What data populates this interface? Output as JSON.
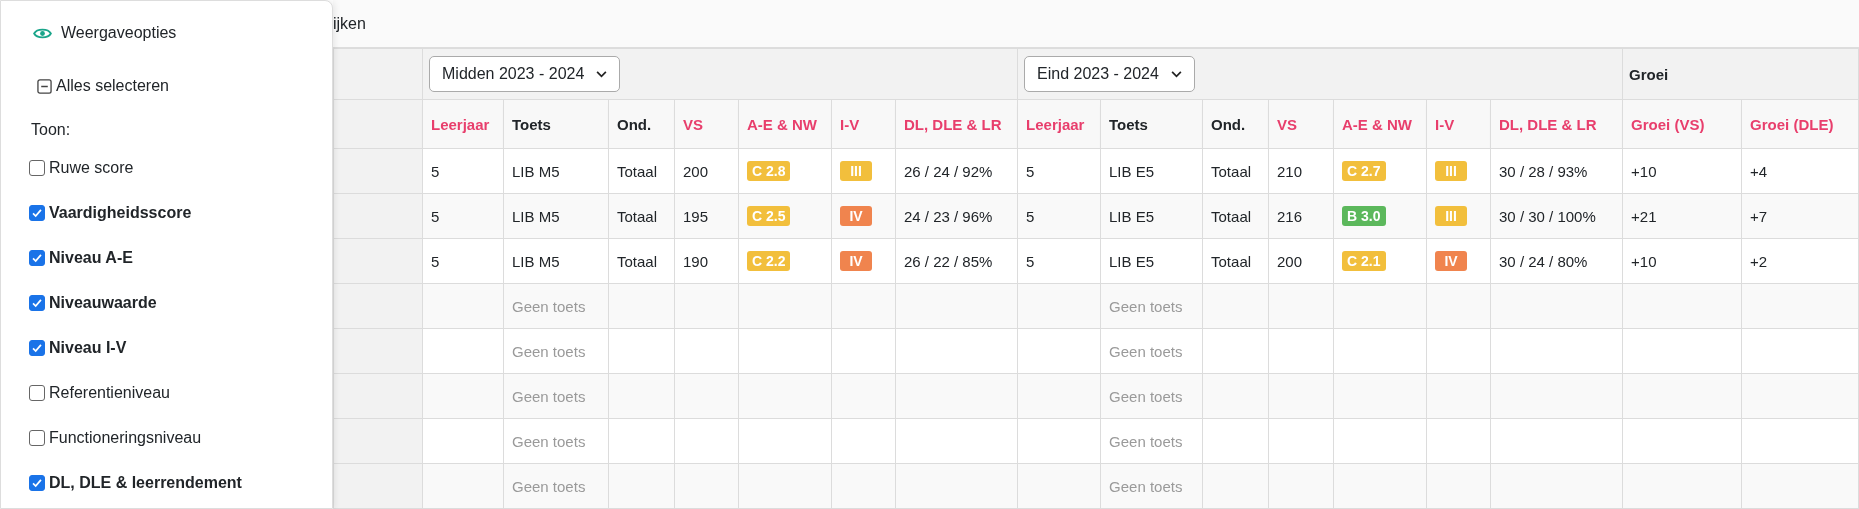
{
  "options_panel": {
    "title": "Weergaveopties",
    "select_all": {
      "label": "Alles selecteren",
      "indeterminate": true
    },
    "show_label": "Toon:",
    "items": [
      {
        "label": "Ruwe score",
        "checked": false
      },
      {
        "label": "Vaardigheidsscore",
        "checked": true
      },
      {
        "label": "Niveau A-E",
        "checked": true
      },
      {
        "label": "Niveauwaarde",
        "checked": true
      },
      {
        "label": "Niveau I-V",
        "checked": true
      },
      {
        "label": "Referentieniveau",
        "checked": false
      },
      {
        "label": "Functioneringsniveau",
        "checked": false
      },
      {
        "label": "DL, DLE & leerrendement",
        "checked": true
      }
    ]
  },
  "top_bar": {
    "text": "ijken"
  },
  "table": {
    "groups": [
      {
        "kind": "select",
        "value": "Midden 2023 - 2024",
        "columns": [
          {
            "label": "Leerjaar",
            "color": "#e83e6c"
          },
          {
            "label": "Toets",
            "color": "#212529"
          },
          {
            "label": "Ond.",
            "color": "#212529"
          },
          {
            "label": "VS",
            "color": "#e83e6c"
          },
          {
            "label": "A-E & NW",
            "color": "#e83e6c"
          },
          {
            "label": "I-V",
            "color": "#e83e6c"
          },
          {
            "label": "DL, DLE & LR",
            "color": "#e83e6c"
          }
        ]
      },
      {
        "kind": "select",
        "value": "Eind 2023 - 2024",
        "columns": [
          {
            "label": "Leerjaar",
            "color": "#e83e6c"
          },
          {
            "label": "Toets",
            "color": "#212529"
          },
          {
            "label": "Ond.",
            "color": "#212529"
          },
          {
            "label": "VS",
            "color": "#e83e6c"
          },
          {
            "label": "A-E & NW",
            "color": "#e83e6c"
          },
          {
            "label": "I-V",
            "color": "#e83e6c"
          },
          {
            "label": "DL, DLE & LR",
            "color": "#e83e6c"
          }
        ]
      },
      {
        "kind": "title",
        "value": "Groei",
        "columns": [
          {
            "label": "Groei (VS)",
            "color": "#e83e6c"
          },
          {
            "label": "Groei (DLE)",
            "color": "#e83e6c"
          }
        ]
      }
    ],
    "rows": [
      {
        "cells": [
          "5",
          "LIB M5",
          "Totaal",
          "200",
          {
            "badge": "C 2.8",
            "color": "#f2bf3c"
          },
          {
            "badge": "III",
            "color": "#f2bf3c"
          },
          "26 / 24 / 92%",
          "5",
          "LIB E5",
          "Totaal",
          "210",
          {
            "badge": "C 2.7",
            "color": "#f2bf3c"
          },
          {
            "badge": "III",
            "color": "#f2bf3c"
          },
          "30 / 28 / 93%",
          "+10",
          "+4"
        ]
      },
      {
        "cells": [
          "5",
          "LIB M5",
          "Totaal",
          "195",
          {
            "badge": "C 2.5",
            "color": "#f2bf3c"
          },
          {
            "badge": "IV",
            "color": "#f0844e"
          },
          "24 / 23 / 96%",
          "5",
          "LIB E5",
          "Totaal",
          "216",
          {
            "badge": "B 3.0",
            "color": "#5cb85c"
          },
          {
            "badge": "III",
            "color": "#f2bf3c"
          },
          "30 / 30 / 100%",
          "+21",
          "+7"
        ]
      },
      {
        "cells": [
          "5",
          "LIB M5",
          "Totaal",
          "190",
          {
            "badge": "C 2.2",
            "color": "#f2bf3c"
          },
          {
            "badge": "IV",
            "color": "#f0844e"
          },
          "26 / 22 / 85%",
          "5",
          "LIB E5",
          "Totaal",
          "200",
          {
            "badge": "C 2.1",
            "color": "#f2bf3c"
          },
          {
            "badge": "IV",
            "color": "#f0844e"
          },
          "30 / 24 / 80%",
          "+10",
          "+2"
        ]
      },
      {
        "cells": [
          null,
          {
            "placeholder": "Geen toets"
          },
          null,
          null,
          null,
          null,
          null,
          null,
          {
            "placeholder": "Geen toets"
          },
          null,
          null,
          null,
          null,
          null,
          null,
          null
        ]
      },
      {
        "cells": [
          null,
          {
            "placeholder": "Geen toets"
          },
          null,
          null,
          null,
          null,
          null,
          null,
          {
            "placeholder": "Geen toets"
          },
          null,
          null,
          null,
          null,
          null,
          null,
          null
        ]
      },
      {
        "cells": [
          null,
          {
            "placeholder": "Geen toets"
          },
          null,
          null,
          null,
          null,
          null,
          null,
          {
            "placeholder": "Geen toets"
          },
          null,
          null,
          null,
          null,
          null,
          null,
          null
        ]
      },
      {
        "cells": [
          null,
          {
            "placeholder": "Geen toets"
          },
          null,
          null,
          null,
          null,
          null,
          null,
          {
            "placeholder": "Geen toets"
          },
          null,
          null,
          null,
          null,
          null,
          null,
          null
        ]
      },
      {
        "cells": [
          null,
          {
            "placeholder": "Geen toets"
          },
          null,
          null,
          null,
          null,
          null,
          null,
          {
            "placeholder": "Geen toets"
          },
          null,
          null,
          null,
          null,
          null,
          null,
          null
        ]
      }
    ]
  }
}
